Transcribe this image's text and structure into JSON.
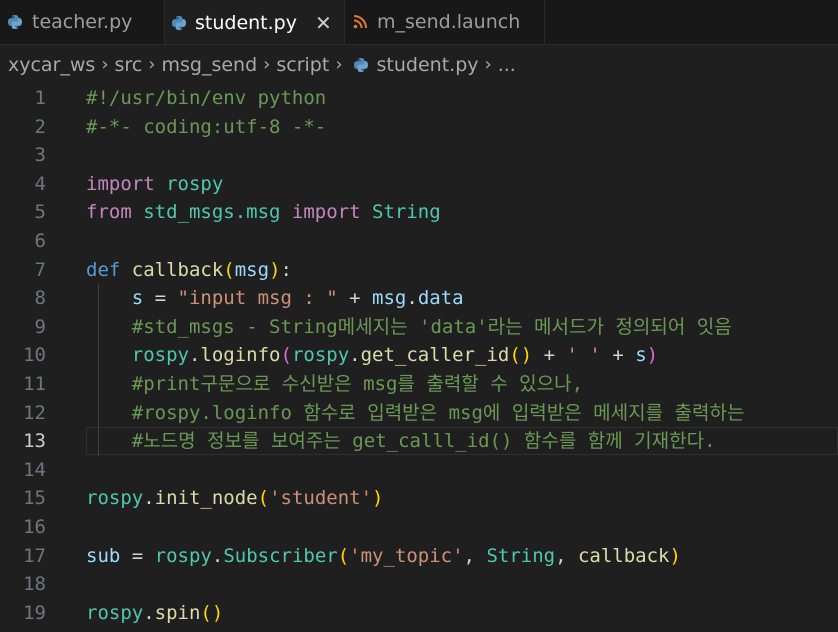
{
  "tabs": [
    {
      "label": "teacher.py",
      "icon": "python-icon"
    },
    {
      "label": "student.py",
      "icon": "python-icon",
      "close": "✕"
    },
    {
      "label": "m_send.launch",
      "icon": "rss-icon"
    }
  ],
  "breadcrumb": {
    "items": [
      "xycar_ws",
      "src",
      "msg_send",
      "script",
      "student.py",
      "..."
    ]
  },
  "colors": {
    "accent_python": "#4b8bbe",
    "launch_icon": "#e37933",
    "comment": "#6a9955",
    "string": "#ce9178",
    "keyword": "#c586c0"
  },
  "editor": {
    "current_line": 13,
    "line_numbers": [
      "1",
      "2",
      "3",
      "4",
      "5",
      "6",
      "7",
      "8",
      "9",
      "10",
      "11",
      "12",
      "13",
      "14",
      "15",
      "16",
      "17",
      "18",
      "19"
    ],
    "lines": {
      "l1": "#!/usr/bin/env python",
      "l2": "#-*- coding:utf-8 -*-",
      "l4_kw": "import",
      "l4_mod": " rospy",
      "l5_kw1": "from",
      "l5_mod": " std_msgs.msg ",
      "l5_kw2": "import",
      "l5_cls": " String",
      "l7_def": "def",
      "l7_fn": " callback",
      "l7_p1": "(",
      "l7_arg": "msg",
      "l7_p2": ")",
      "l7_colon": ":",
      "l8_indent": "    ",
      "l8_var": "s",
      "l8_eq": " = ",
      "l8_str": "\"input msg : \"",
      "l8_plus": " + ",
      "l8_msg": "msg",
      "l8_dot": ".",
      "l8_data": "data",
      "l9": "    #std_msgs - String메세지는 'data'라는 메서드가 정의되어 잇음",
      "l10_indent": "    ",
      "l10_rospy": "rospy",
      "l10_dot": ".",
      "l10_fn": "loginfo",
      "l10_p1": "(",
      "l10_rospy2": "rospy",
      "l10_dot2": ".",
      "l10_fn2": "get_caller_id",
      "l10_p2": "()",
      "l10_plus": " + ",
      "l10_str": "' '",
      "l10_plus2": " + ",
      "l10_s": "s",
      "l10_p3": ")",
      "l11": "    #print구문으로 수신받은 msg를 출력할 수 있으나,",
      "l12": "    #rospy.loginfo 함수로 입력받은 msg에 입력받은 메세지를 출력하는",
      "l13": "    #노드명 정보를 보여주는 get_calll_id() 함수를 함께 기재한다.",
      "l15_rospy": "rospy",
      "l15_dot": ".",
      "l15_fn": "init_node",
      "l15_p1": "(",
      "l15_str": "'student'",
      "l15_p2": ")",
      "l17_sub": "sub",
      "l17_eq": " = ",
      "l17_rospy": "rospy",
      "l17_dot": ".",
      "l17_cls": "Subscriber",
      "l17_p1": "(",
      "l17_str": "'my_topic'",
      "l17_c1": ", ",
      "l17_cls2": "String",
      "l17_c2": ", ",
      "l17_cb": "callback",
      "l17_p2": ")",
      "l19_rospy": "rospy",
      "l19_dot": ".",
      "l19_fn": "spin",
      "l19_p": "()"
    }
  }
}
